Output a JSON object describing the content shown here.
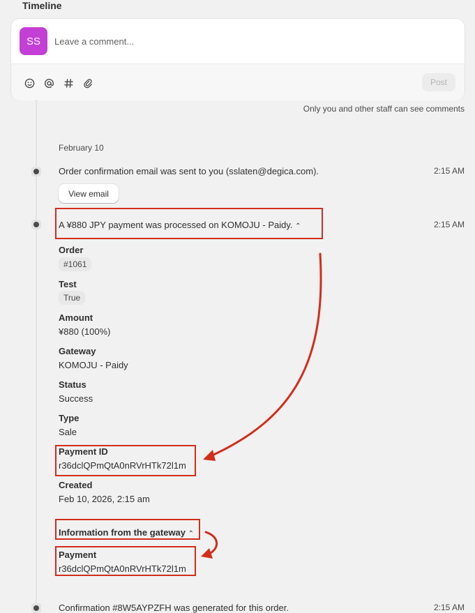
{
  "timeline": {
    "title": "Timeline",
    "avatar_initials": "SS",
    "comment_placeholder": "Leave a comment...",
    "post_label": "Post",
    "staff_note": "Only you and other staff can see comments",
    "toolbar_icons": [
      "emoji-icon",
      "mention-icon",
      "hashtag-icon",
      "attachment-icon"
    ]
  },
  "events": {
    "date_header": "February 10",
    "email_event": {
      "text": "Order confirmation email was sent to you (sslaten@degica.com).",
      "time": "2:15 AM",
      "button": "View email"
    },
    "payment_event": {
      "text": "A ¥880 JPY payment was processed on KOMOJU - Paidy.",
      "time": "2:15 AM",
      "details": {
        "order_label": "Order",
        "order_value": "#1061",
        "test_label": "Test",
        "test_value": "True",
        "amount_label": "Amount",
        "amount_value": "¥880 (100%)",
        "gateway_label": "Gateway",
        "gateway_value": "KOMOJU - Paidy",
        "status_label": "Status",
        "status_value": "Success",
        "type_label": "Type",
        "type_value": "Sale",
        "payment_id_label": "Payment ID",
        "payment_id_value": "r36dclQPmQtA0nRVrHTk72l1m",
        "created_label": "Created",
        "created_value": "Feb 10, 2026, 2:15 am"
      },
      "gateway_info": {
        "label": "Information from the gateway",
        "payment_label": "Payment",
        "payment_value": "r36dclQPmQtA0nRVrHTk72l1m"
      }
    },
    "confirmation_event": {
      "text": "Confirmation #8W5AYPZFH was generated for this order.",
      "time": "2:15 AM"
    }
  },
  "colors": {
    "avatar": "#c33fd5",
    "annotation_red": "#d22d1b",
    "background": "#f1f1f1"
  }
}
